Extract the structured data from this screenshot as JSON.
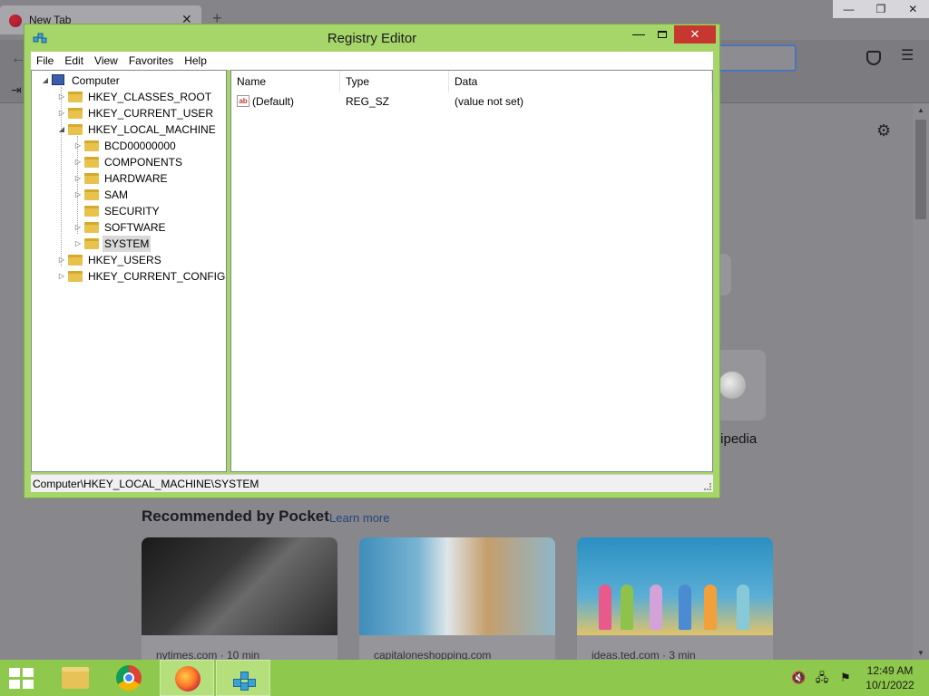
{
  "firefox": {
    "tab_title": "New Tab",
    "tab_close": "✕",
    "new_tab": "+",
    "window_controls": [
      "—",
      "❐",
      "✕"
    ],
    "back": "←",
    "menu": "☰",
    "import": "⇥",
    "gear": "⚙",
    "shortcut_label": "tipedia",
    "pocket": {
      "heading": "Recommended by Pocket",
      "learn_more": "Learn more",
      "cards": [
        {
          "source": "nytimes.com · 10 min"
        },
        {
          "source": "capitaloneshopping.com"
        },
        {
          "source": "ideas.ted.com · 3 min"
        }
      ]
    }
  },
  "regedit": {
    "title": "Registry Editor",
    "buttons": {
      "minimize": "—",
      "close": "✕"
    },
    "menu": [
      "File",
      "Edit",
      "View",
      "Favorites",
      "Help"
    ],
    "tree": {
      "root": "Computer",
      "hives": [
        {
          "label": "HKEY_CLASSES_ROOT"
        },
        {
          "label": "HKEY_CURRENT_USER"
        },
        {
          "label": "HKEY_LOCAL_MACHINE"
        },
        {
          "label": "HKEY_USERS"
        },
        {
          "label": "HKEY_CURRENT_CONFIG"
        }
      ],
      "hklm_children": [
        {
          "label": "BCD00000000"
        },
        {
          "label": "COMPONENTS"
        },
        {
          "label": "HARDWARE"
        },
        {
          "label": "SAM"
        },
        {
          "label": "SECURITY"
        },
        {
          "label": "SOFTWARE"
        },
        {
          "label": "SYSTEM"
        }
      ],
      "selected": "SYSTEM"
    },
    "list": {
      "columns": [
        "Name",
        "Type",
        "Data"
      ],
      "rows": [
        {
          "icon": "ab",
          "name": "(Default)",
          "type": "REG_SZ",
          "data": "(value not set)"
        }
      ]
    },
    "status": "Computer\\HKEY_LOCAL_MACHINE\\SYSTEM"
  },
  "taskbar": {
    "apps": [
      "File Explorer",
      "Google Chrome",
      "Firefox",
      "Registry Editor"
    ],
    "clock": {
      "time": "12:49 AM",
      "date": "10/1/2022"
    },
    "tray": [
      "volume-muted-icon",
      "network-icon",
      "action-center-flag-icon"
    ]
  },
  "colors": {
    "window_frame": "#a6d56a",
    "taskbar": "#8ec84c",
    "close_button": "#c7372f",
    "selection": "#d9d9d9"
  }
}
